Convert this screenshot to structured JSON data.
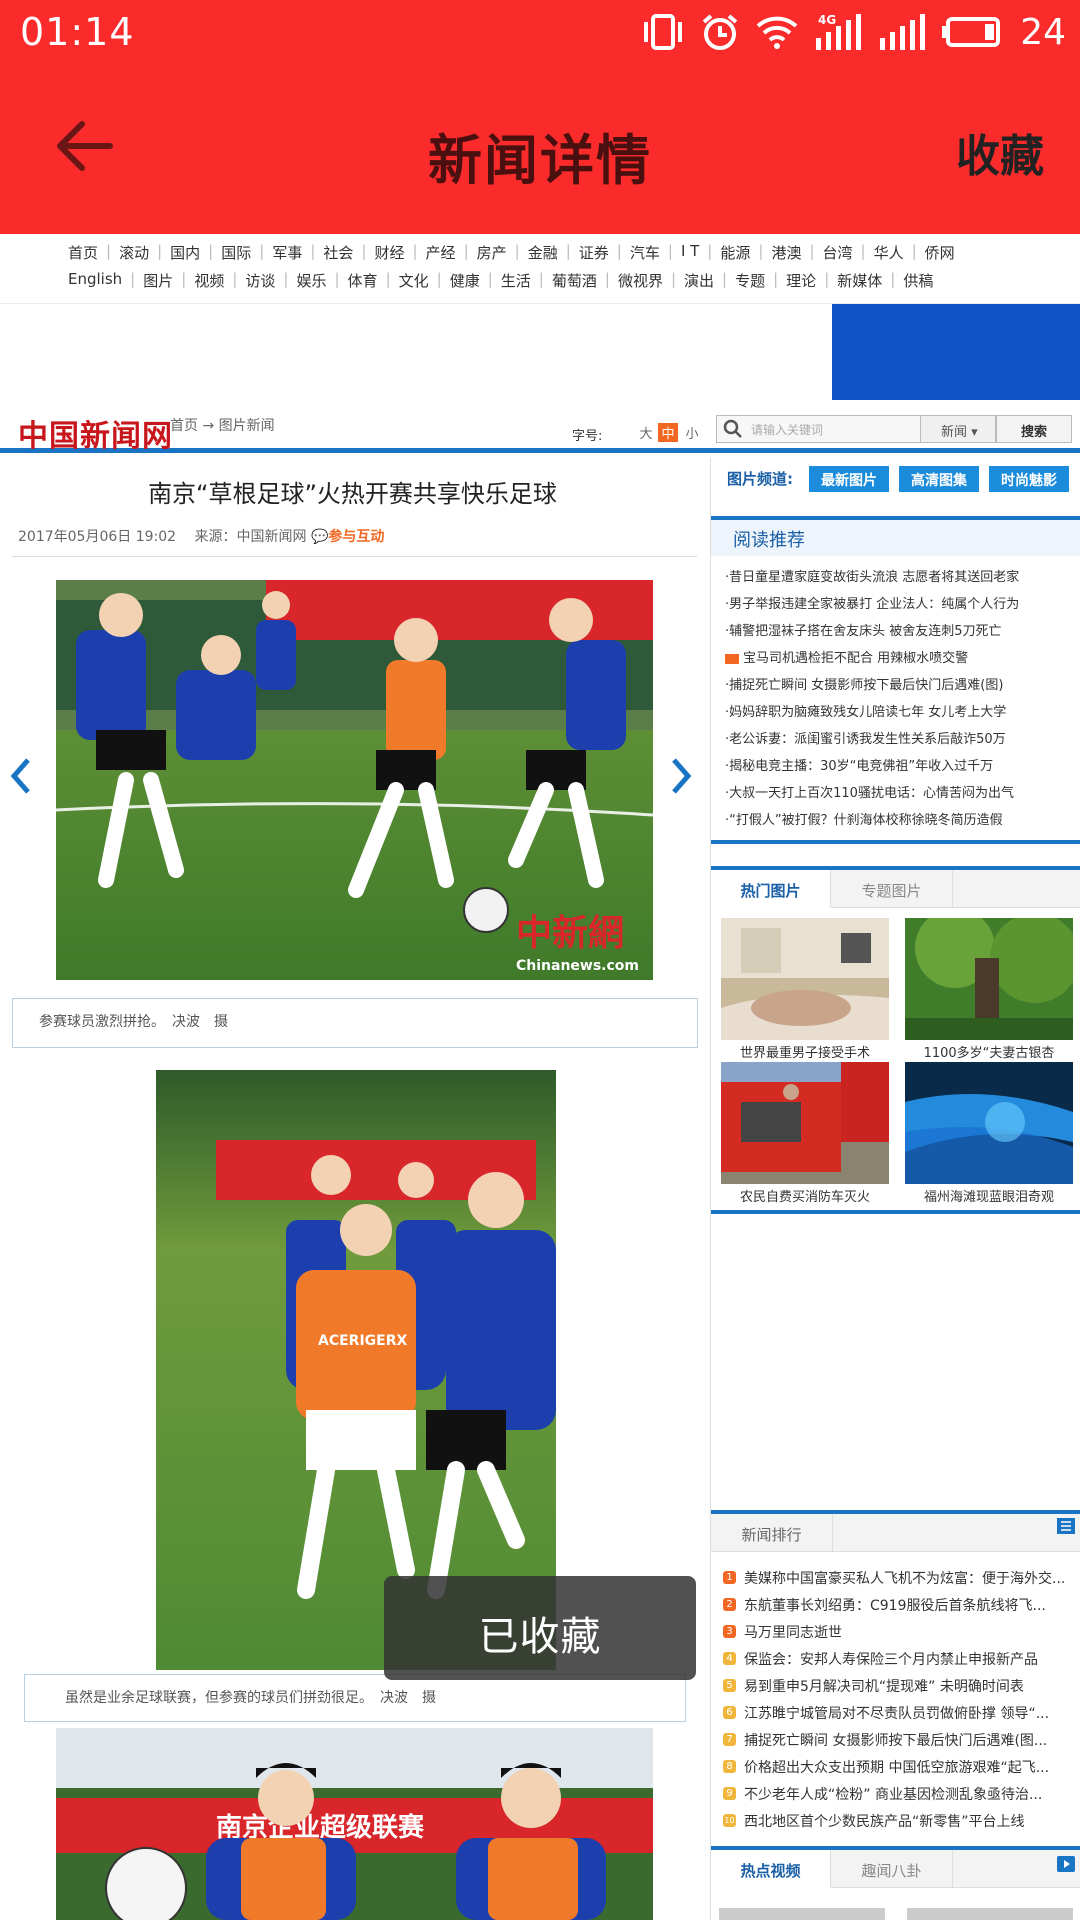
{
  "status_bar": {
    "time": "01:14",
    "battery": "24",
    "network": "4G"
  },
  "app_bar": {
    "title": "新闻详情",
    "favorite_label": "收藏",
    "back_icon": "arrow-left-icon"
  },
  "site_nav": {
    "row1": [
      "首页",
      "滚动",
      "国内",
      "国际",
      "军事",
      "社会",
      "财经",
      "产经",
      "房产",
      "金融",
      "证券",
      "汽车",
      "I T",
      "能源",
      "港澳",
      "台湾",
      "华人",
      "侨网"
    ],
    "row2": [
      "English",
      "图片",
      "视频",
      "访谈",
      "娱乐",
      "体育",
      "文化",
      "健康",
      "生活",
      "葡萄酒",
      "微视界",
      "演出",
      "专题",
      "理论",
      "新媒体",
      "供稿"
    ]
  },
  "site_header": {
    "logo": "中国新闻网",
    "breadcrumb": "首页 → 图片新闻",
    "font_size_label": "字号:",
    "font_sizes": [
      "大",
      "中",
      "小"
    ],
    "search_placeholder": "请输入关键词",
    "search_category": "新闻",
    "search_button": "搜索"
  },
  "article": {
    "title": "南京“草根足球”火热开赛共享快乐足球",
    "date": "2017年05月06日 19:02",
    "source": "来源：中国新闻网",
    "interact": "参与互动",
    "photo1_caption": "参赛球员激烈拼抢。　决波　摄",
    "photo2_caption": "虽然是业余足球联赛，但参赛的球员们拼劲很足。　决波　摄",
    "watermark_cn": "中新網",
    "watermark_en": "Chinanews.com",
    "jersey_text": "ACERIGERX",
    "banner_text": "南京企业超级联赛"
  },
  "sidebar": {
    "photo_channel_label": "图片频道:",
    "photo_channel_buttons": [
      "最新图片",
      "高清图集",
      "时尚魅影"
    ],
    "reading_title": "阅读推荐",
    "reading_items": [
      "·昔日童星遭家庭变故街头流浪 志愿者将其送回老家",
      "·男子举报违建全家被暴打 企业法人：纯属个人行为",
      "·辅警把湿袜子搭在舍友床头 被舍友连刺5刀死亡",
      "宝马司机遇检拒不配合 用辣椒水喷交警",
      "·捕捉死亡瞬间 女摄影师按下最后快门后遇难(图)",
      "·妈妈辞职为脑瘫致残女儿陪读七年 女儿考上大学",
      "·老公诉妻：派闺蜜引诱我发生性关系后敲诈50万",
      "·揭秘电竞主播：30岁“电竞佛祖”年收入过千万",
      "·大叔一天打上百次110骚扰电话：心情苦闷为出气",
      "·“打假人”被打假？什刹海体校称徐晓冬简历造假"
    ],
    "hot_tabs": [
      "热门图片",
      "专题图片"
    ],
    "hot_photos": [
      "世界最重男子接受手术",
      "1100多岁“夫妻古银杏",
      "农民自费买消防车灭火",
      "福州海滩现蓝眼泪奇观"
    ],
    "rank_tabs": [
      "新闻排行"
    ],
    "rank_items": [
      "美媒称中国富豪买私人飞机不为炫富：便于海外交...",
      "东航董事长刘绍勇：C919服役后首条航线将飞...",
      "马万里同志逝世",
      "保监会：安邦人寿保险三个月内禁止申报新产品",
      "易到重申5月解决司机“提现难” 未明确时间表",
      "江苏睢宁城管局对不尽责队员罚做俯卧撑 领导“...",
      "捕捉死亡瞬间 女摄影师按下最后快门后遇难(图...",
      "价格超出大众支出预期 中国低空旅游艰难“起飞...",
      "不少老年人成“检粉” 商业基因检测乱象亟待治...",
      "西北地区首个少数民族产品“新零售”平台上线"
    ],
    "rank_numbers": [
      "1",
      "2",
      "3",
      "4",
      "5",
      "6",
      "7",
      "8",
      "9",
      "10"
    ],
    "video_tabs": [
      "热点视频",
      "趣闻八卦"
    ]
  },
  "toast": {
    "text": "已收藏"
  },
  "colors": {
    "brand_red": "#fb2b2b",
    "link_blue": "#1a74c4",
    "accent_orange": "#f26722"
  }
}
